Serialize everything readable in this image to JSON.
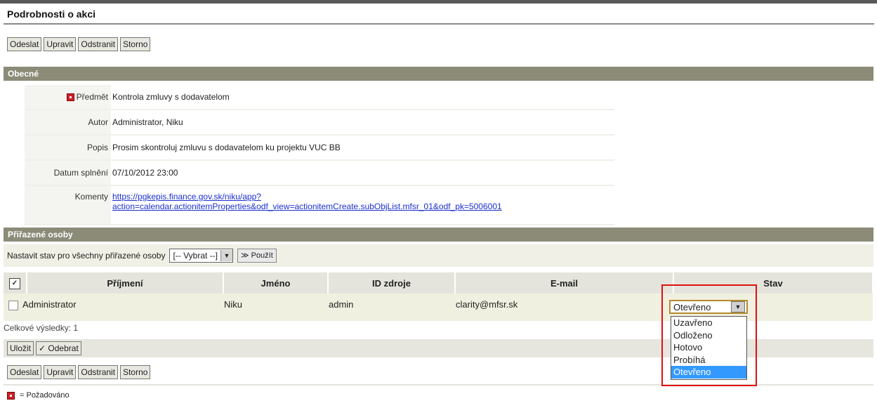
{
  "page": {
    "title": "Podrobnosti o akci"
  },
  "toolbar": {
    "buttons": [
      "Odeslat",
      "Upravit",
      "Odstranit",
      "Storno"
    ]
  },
  "general": {
    "header": "Obecné",
    "fields": {
      "subject_label": "Předmět",
      "subject_value": "Kontrola zmluvy s dodavatelom",
      "author_label": "Autor",
      "author_value": "Administrator, Niku",
      "description_label": "Popis",
      "description_value": "Prosim skontroluj zmluvu s dodavatelom ku projektu VUC BB",
      "due_label": "Datum splnění",
      "due_value": "07/10/2012 23:00",
      "comments_label": "Komenty",
      "comments_link_line1": "https://pgkepis.finance.gov.sk/niku/app?",
      "comments_link_line2": "action=calendar.actionitemProperties&odf_view=actionitemCreate.subObjList.mfsr_01&odf_pk=5006001"
    }
  },
  "assigned": {
    "header": "Přiřazené osoby",
    "filter_label": "Nastavit stav pro všechny přiřazené osoby",
    "filter_select": "[-- Vybrat --]",
    "apply_label": "Použít",
    "columns": [
      "Příjmení",
      "Jméno",
      "ID zdroje",
      "E-mail",
      "Stav"
    ],
    "rows": [
      {
        "last_name": "Administrator",
        "first_name": "Niku",
        "resource_id": "admin",
        "email": "clarity@mfsr.sk",
        "status": "Otevřeno"
      }
    ],
    "total": "Celkové výsledky: 1",
    "save_label": "Uložit",
    "remove_label": "Odebrat",
    "status_options": [
      "Uzavřeno",
      "Odloženo",
      "Hotovo",
      "Probíhá",
      "Otevřeno"
    ],
    "status_selected": "Otevřeno"
  },
  "legend": {
    "text": "= Požadováno"
  },
  "colors": {
    "section_header": "#8b8b78",
    "highlight_box": "#e01010",
    "selected_option": "#3399ff"
  }
}
